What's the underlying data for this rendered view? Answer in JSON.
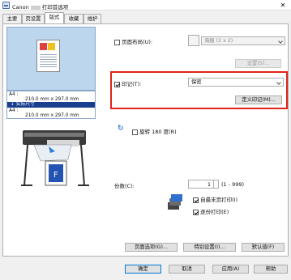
{
  "window": {
    "title_prefix": "Canon",
    "title_suffix": "打印首选项",
    "close_glyph": "✕"
  },
  "tabs": [
    {
      "label": "主要"
    },
    {
      "label": "页设置"
    },
    {
      "label": "版式"
    },
    {
      "label": "收藏"
    },
    {
      "label": "维护"
    }
  ],
  "preview": {
    "size_top": "A4 :",
    "size_top_dims": "210.0 mm x 297.0 mm",
    "selected": "实际尺寸",
    "size_bottom": "A4 :",
    "size_bottom_dims": "210.0 mm x 297.0 mm"
  },
  "page_layout": {
    "label": "页面布局(U):",
    "value": "海报 (2 x 2)",
    "checked": false,
    "settings_button": "设置(S)..."
  },
  "stamp": {
    "label": "印记(T):",
    "value": "保密",
    "checked": true,
    "define_button": "定义印记(M)..."
  },
  "rotate": {
    "label": "旋转 180 度(R)",
    "checked": false
  },
  "copies": {
    "label": "份数(C):",
    "value": "1",
    "range": "(1 - 999)",
    "reverse_label": "自最末页打印(I)",
    "reverse_checked": true,
    "collate_label": "逐份打印(E)",
    "collate_checked": true
  },
  "bottom_buttons": {
    "page_options": "页面选项(G)...",
    "special": "特别设置(I)...",
    "defaults": "默认值(F)"
  },
  "dialog_buttons": {
    "ok": "确定",
    "cancel": "取消",
    "apply": "应用(A)",
    "help": "帮助"
  },
  "colors": {
    "accent": "#0078d7",
    "highlight_box": "#e0231a",
    "preview_bg": "#bcd6ee"
  }
}
